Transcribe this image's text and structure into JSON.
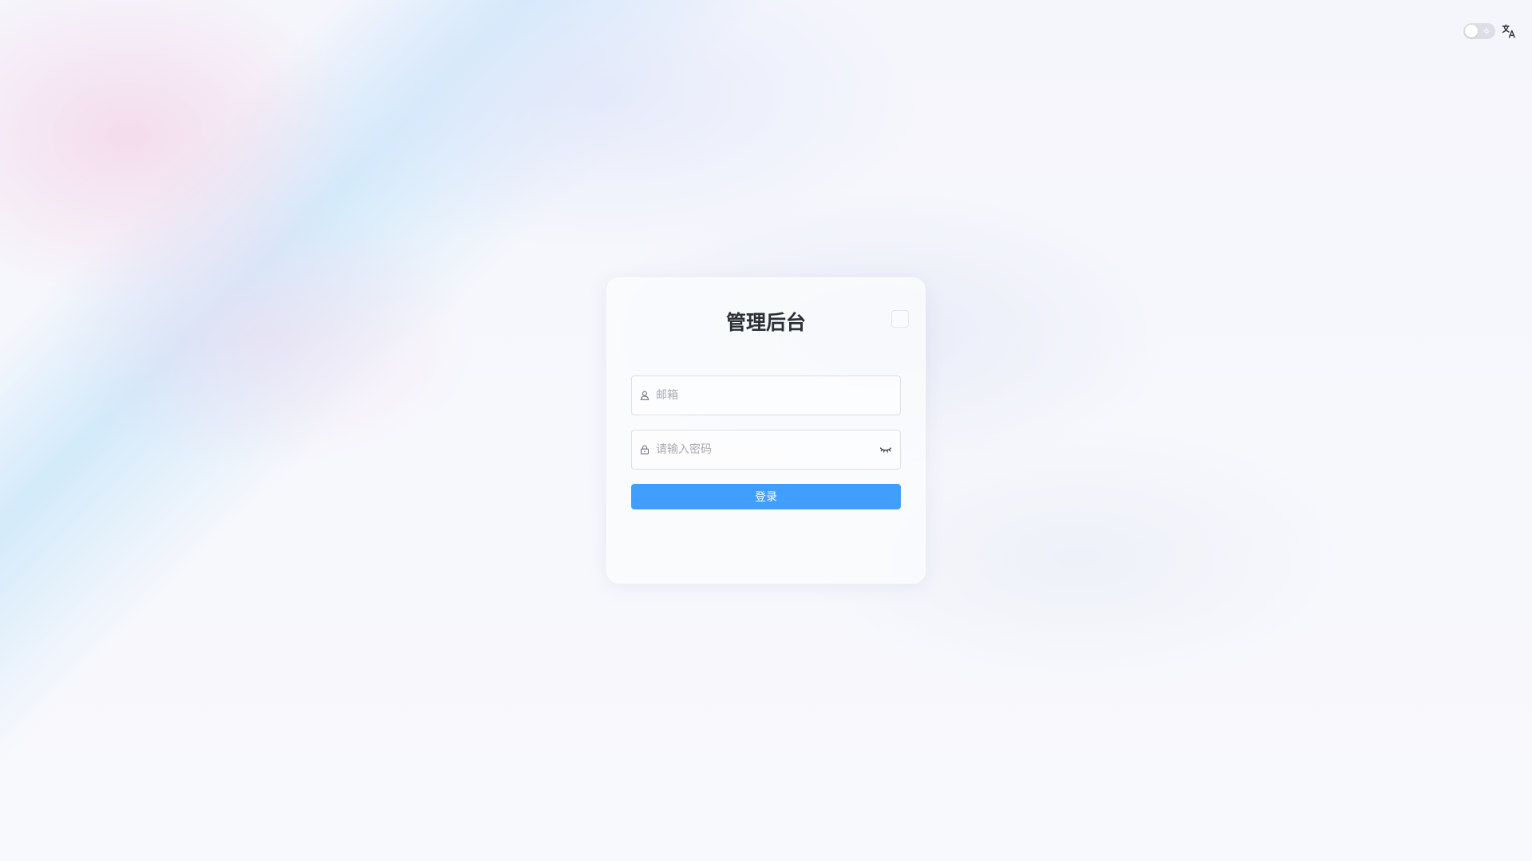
{
  "header": {
    "theme_toggle": {
      "state": "off",
      "icon": "sun-icon"
    },
    "language_icon": "translate-icon"
  },
  "login": {
    "title": "管理后台",
    "email": {
      "value": "",
      "placeholder": "邮箱",
      "icon": "user-icon"
    },
    "password": {
      "value": "",
      "placeholder": "请输入密码",
      "icon": "lock-icon",
      "toggle_icon": "eye-closed-icon"
    },
    "submit_label": "登录"
  },
  "colors": {
    "primary": "#409eff",
    "title": "#2b2f36",
    "placeholder": "#a8abb2",
    "border": "#dcdfe6"
  }
}
